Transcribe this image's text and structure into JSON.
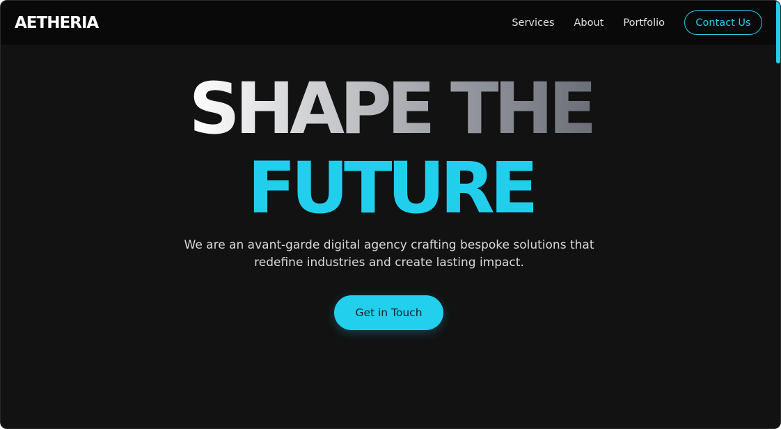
{
  "brand": {
    "logo": "AETHERIA"
  },
  "nav": {
    "links": [
      "Services",
      "About",
      "Portfolio"
    ],
    "contact_label": "Contact Us"
  },
  "hero": {
    "title_line1": "SHAPE THE",
    "title_line2": "FUTURE",
    "subtitle": "We are an avant-garde digital agency crafting bespoke solutions that redefine industries and create lasting impact.",
    "cta_label": "Get in Touch"
  },
  "colors": {
    "accent": "#22cfed",
    "background": "#121212",
    "navbar": "#090909",
    "text": "#ffffff"
  }
}
